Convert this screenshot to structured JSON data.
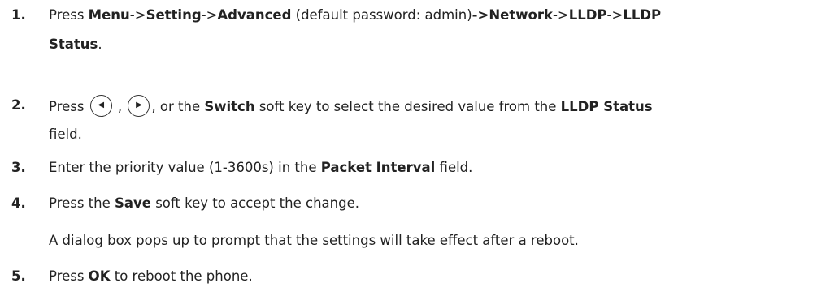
{
  "steps": [
    {
      "number": "1.",
      "parts": [
        {
          "text": "Press ",
          "bold": false
        },
        {
          "text": "Menu",
          "bold": true
        },
        {
          "text": "->",
          "bold": false
        },
        {
          "text": "Setting",
          "bold": true
        },
        {
          "text": "->",
          "bold": false
        },
        {
          "text": "Advanced",
          "bold": true
        },
        {
          "text": " (default password: admin)",
          "bold": false
        },
        {
          "text": "->",
          "bold": true
        },
        {
          "text": "Network",
          "bold": true
        },
        {
          "text": "->",
          "bold": false
        },
        {
          "text": "LLDP",
          "bold": true
        },
        {
          "text": "->",
          "bold": false
        },
        {
          "text": "LLDP",
          "bold": true
        }
      ],
      "line2": "Status",
      "line2_suffix": "."
    },
    {
      "number": "2.",
      "press": "Press",
      "left_icon": "left-nav-key-icon",
      "right_icon": "right-nav-key-icon",
      "left_glyph": "◀",
      "right_glyph": "▶",
      "text_a": ", or the ",
      "bold_a": "Switch",
      "text_b": " soft key to select the desired value from the ",
      "bold_b": "LLDP Status",
      "line2": "field."
    },
    {
      "number": "3.",
      "text_a": "Enter the priority value (1-3600s) in the ",
      "bold_a": "Packet Interval",
      "text_b": " field."
    },
    {
      "number": "4.",
      "text_a": "Press the ",
      "bold_a": "Save",
      "text_b": " soft key to accept the change.",
      "note": "A dialog box pops up to prompt that the settings will take effect after a reboot."
    },
    {
      "number": "5.",
      "text_a": "Press ",
      "bold_a": "OK",
      "text_b": " to reboot the phone."
    }
  ]
}
